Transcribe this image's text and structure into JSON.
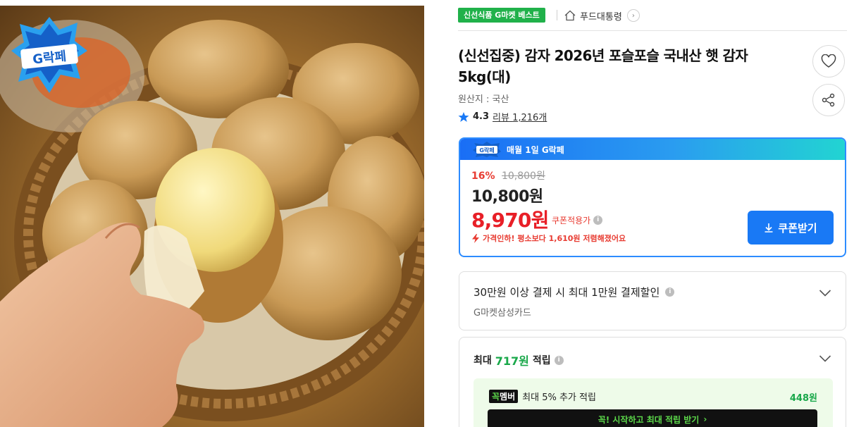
{
  "image": {
    "badge_text": "G락페",
    "alt": ""
  },
  "topbar": {
    "best_badge": "신선식품 G마켓 베스트",
    "brand_link": "푸드대통령",
    "brand_chevron": "›"
  },
  "product": {
    "title": "(신선집중) 감자 2026년 포슬포슬 국내산 햇 감자 5kg(대)",
    "origin": "원산지 : 국산",
    "rating": "4.3",
    "review_label": "리뷰",
    "review_count": "1,216개"
  },
  "price_box": {
    "header_badge": "G락페",
    "header_text": "매월 1일 G락페",
    "discount_rate": "16%",
    "original_price": "10,800원",
    "price": "10,800원",
    "coupon_price": "8,970원",
    "coupon_applied": "쿠폰적용가",
    "price_drop": "가격인하! 평소보다 1,610원 저렴해졌어요",
    "coupon_button": "쿠폰받기"
  },
  "card_discount": {
    "title": "30만원 이상 결제 시 최대 1만원 결제할인",
    "subtitle": "G마켓삼성카드"
  },
  "card_points": {
    "prefix": "최대",
    "amount": "717원",
    "suffix": "적립",
    "member_badge_a": "꼭",
    "member_badge_b": "멤버",
    "member_text": "최대 5% 추가 적립",
    "member_points": "448원",
    "member_cta": "꼭! 시작하고 최대 적립 받기",
    "member_cta_chevron": "›"
  },
  "colors": {
    "accent_blue": "#1979f5",
    "sale_red": "#e81f27",
    "green": "#20b14a"
  },
  "icons": [
    "home-icon",
    "heart-icon",
    "share-icon",
    "star-icon",
    "info-icon",
    "bolt-icon",
    "download-icon",
    "chevron-down-icon"
  ]
}
